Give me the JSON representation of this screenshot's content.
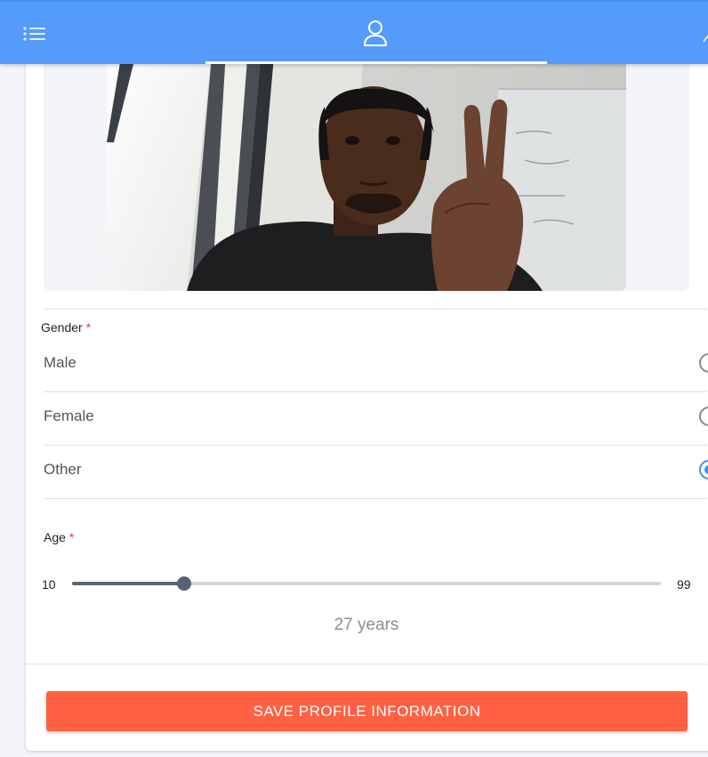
{
  "header": {
    "menu_icon": "list-menu-icon",
    "profile_tab_icon": "user-icon"
  },
  "profile_form": {
    "gender": {
      "label": "Gender",
      "required_mark": "*",
      "options": [
        {
          "label": "Male",
          "selected": false
        },
        {
          "label": "Female",
          "selected": false
        },
        {
          "label": "Other",
          "selected": true
        }
      ]
    },
    "age": {
      "label": "Age",
      "required_mark": "*",
      "min_label": "10",
      "max_label": "99",
      "value": 27,
      "value_text": "27 years"
    },
    "save_label": "SAVE PROFILE INFORMATION"
  },
  "colors": {
    "header": "#559bfb",
    "accent": "#3e8ef7",
    "save_button": "#ff6142",
    "required": "#e53935"
  }
}
